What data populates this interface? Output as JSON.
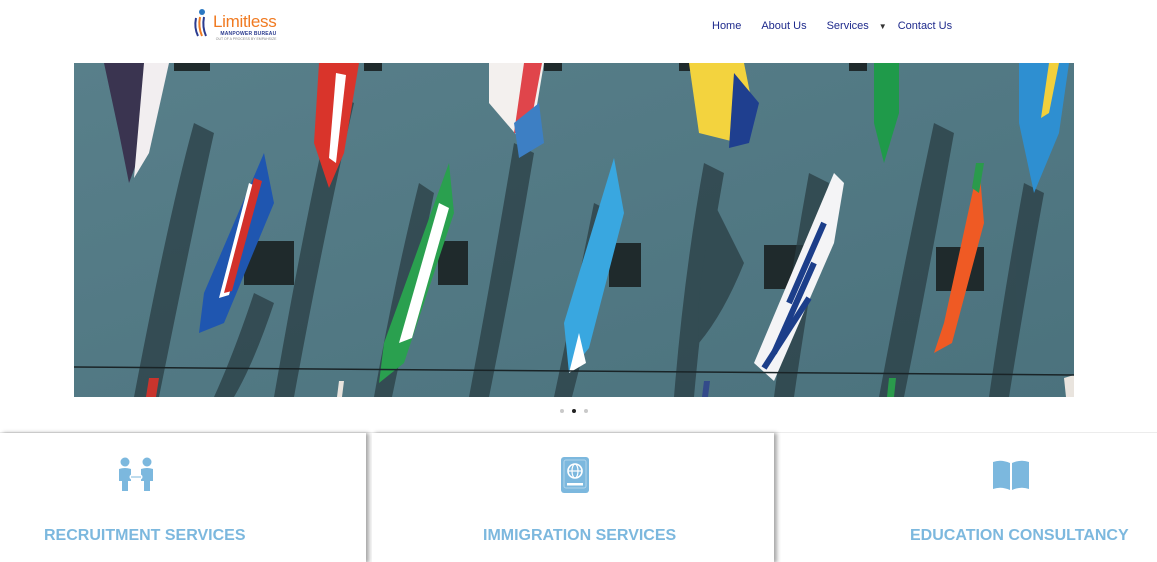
{
  "brand": {
    "name": "Limitless",
    "subtitle": "MANPOWER BUREAU",
    "tagline": "OUT OF A PROCESS BY EMPAHSIZE"
  },
  "nav": {
    "items": [
      "Home",
      "About Us",
      "Services",
      "Contact Us"
    ],
    "caret": "▼"
  },
  "slider": {
    "slide_count": 3,
    "active_index": 1
  },
  "services": [
    {
      "title": "RECRUITMENT SERVICES",
      "icon": "people-exchange-icon"
    },
    {
      "title": "IMMIGRATION SERVICES",
      "icon": "passport-icon"
    },
    {
      "title": "EDUCATION CONSULTANCY",
      "icon": "open-book-icon"
    }
  ],
  "colors": {
    "accent": "#7cb8de",
    "nav": "#1e2a8c",
    "brand_orange": "#f07a21",
    "brand_blue": "#2b3b8f"
  }
}
